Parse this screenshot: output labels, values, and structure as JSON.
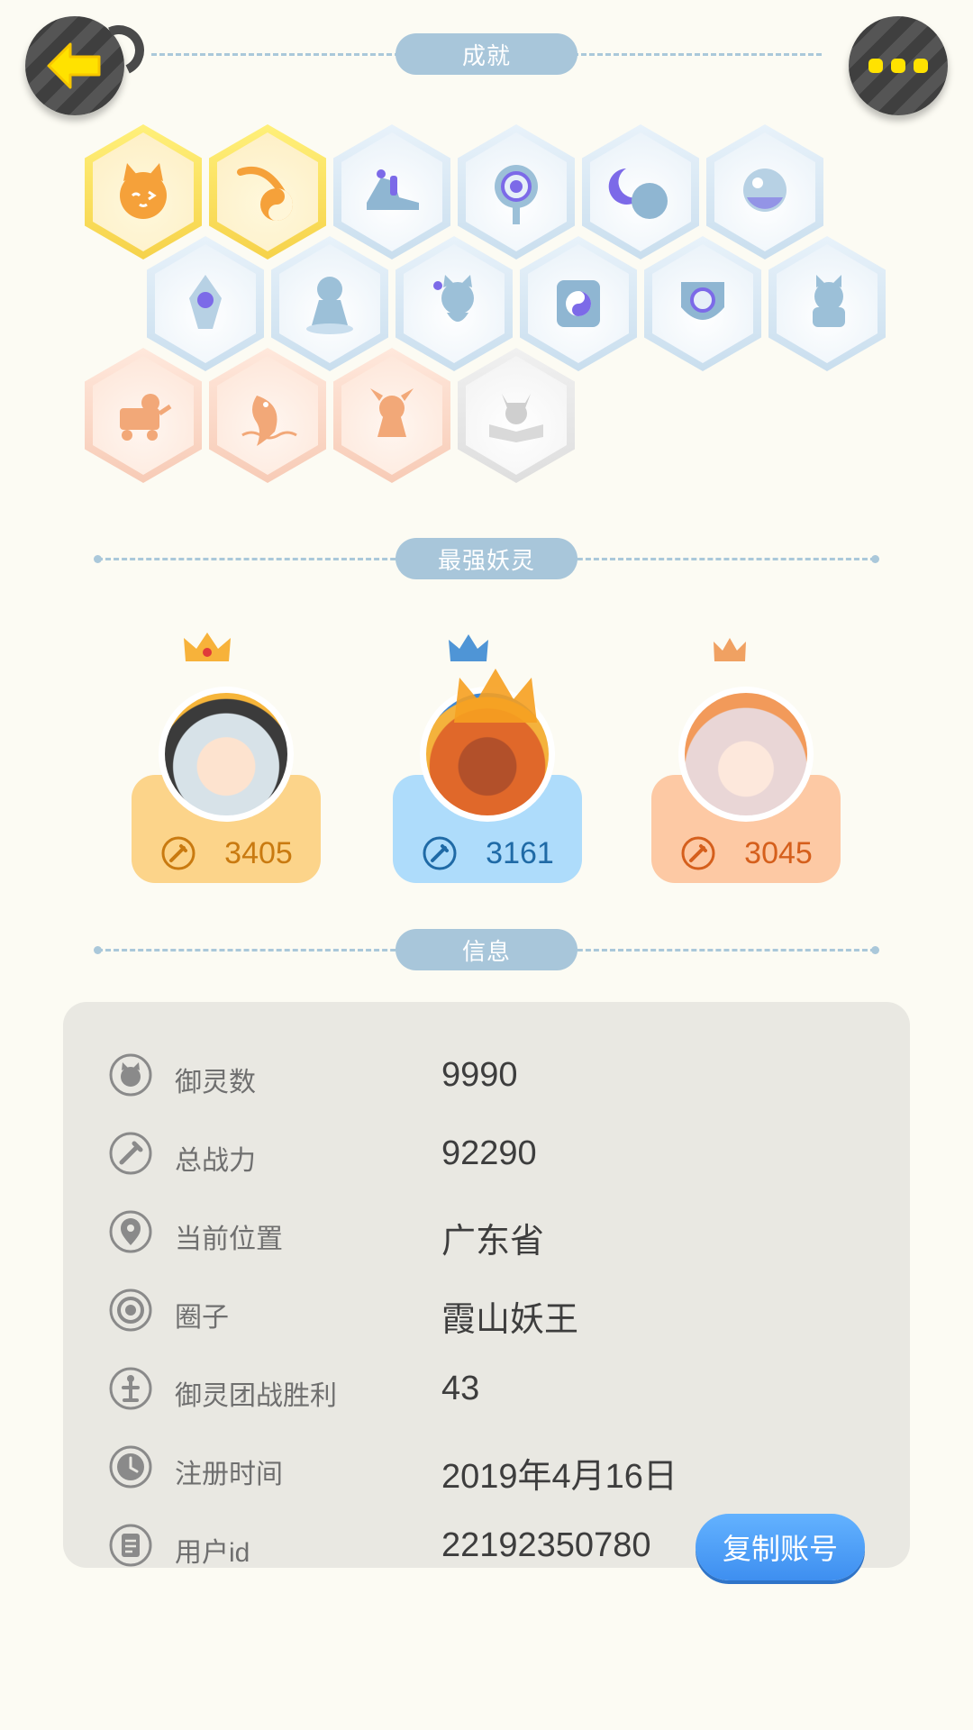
{
  "header": {
    "back_icon": "arrow-left-icon",
    "more_icon": "ellipsis-icon",
    "accent": "#f8d000"
  },
  "sections": {
    "achievements_title": "成就",
    "strongest_title": "最强妖灵",
    "info_title": "信息"
  },
  "achievements": [
    {
      "icon": "fox-face-icon",
      "tier": "gold"
    },
    {
      "icon": "yin-yang-flame-icon",
      "tier": "gold"
    },
    {
      "icon": "sneaker-icon",
      "tier": "blue"
    },
    {
      "icon": "portal-icon",
      "tier": "blue"
    },
    {
      "icon": "moon-sphere-icon",
      "tier": "blue"
    },
    {
      "icon": "crystal-ball-icon",
      "tier": "blue"
    },
    {
      "icon": "crystal-icon",
      "tier": "blue"
    },
    {
      "icon": "spirit-statue-icon",
      "tier": "blue"
    },
    {
      "icon": "cat-spirit-icon",
      "tier": "blue"
    },
    {
      "icon": "yin-yang-box-icon",
      "tier": "blue"
    },
    {
      "icon": "shield-icon",
      "tier": "blue"
    },
    {
      "icon": "cat-statue-icon",
      "tier": "blue"
    },
    {
      "icon": "cat-cart-icon",
      "tier": "peach"
    },
    {
      "icon": "koi-fish-icon",
      "tier": "peach"
    },
    {
      "icon": "horned-creature-icon",
      "tier": "peach"
    },
    {
      "icon": "fox-book-icon",
      "tier": "grey"
    }
  ],
  "strongest": [
    {
      "rank": "gold",
      "power": "3405",
      "avatar": "silver-haired-girl-avatar"
    },
    {
      "rank": "silver",
      "power": "3161",
      "avatar": "flame-warrior-avatar"
    },
    {
      "rank": "bronze",
      "power": "3045",
      "avatar": "pink-haired-girl-avatar"
    }
  ],
  "info": {
    "rows": [
      {
        "icon": "creature-icon",
        "label": "御灵数",
        "value": "9990"
      },
      {
        "icon": "sword-icon",
        "label": "总战力",
        "value": "92290"
      },
      {
        "icon": "location-pin-icon",
        "label": "当前位置",
        "value": "广东省"
      },
      {
        "icon": "circle-target-icon",
        "label": "圈子",
        "value": "霞山妖王"
      },
      {
        "icon": "trophy-icon",
        "label": "御灵团战胜利",
        "value": "43"
      },
      {
        "icon": "clock-icon",
        "label": "注册时间",
        "value": "2019年4月16日"
      },
      {
        "icon": "id-card-icon",
        "label": "用户id",
        "value": "22192350780"
      }
    ],
    "copy_button": "复制账号"
  }
}
